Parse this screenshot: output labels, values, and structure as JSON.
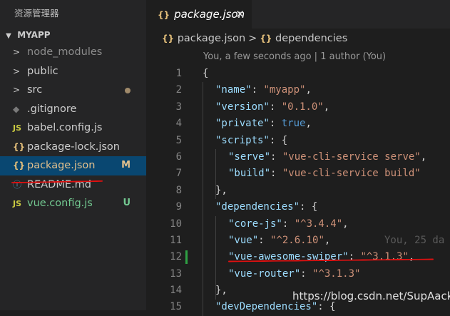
{
  "explorer": {
    "title": "资源管理器",
    "folder": "MYAPP",
    "items": [
      {
        "label": "node_modules",
        "icon": ">",
        "icon_name": "chevron-right-icon",
        "color": "#8c8c8c",
        "icon_color": "#cccccc"
      },
      {
        "label": "public",
        "icon": ">",
        "icon_name": "chevron-right-icon",
        "color": "#cccccc",
        "icon_color": "#cccccc"
      },
      {
        "label": "src",
        "icon": ">",
        "icon_name": "chevron-right-icon",
        "color": "#cccccc",
        "icon_color": "#cccccc"
      },
      {
        "label": ".gitignore",
        "icon": "◆",
        "icon_name": "git-icon",
        "color": "#cccccc",
        "icon_color": "#7a7a7a"
      },
      {
        "label": "babel.config.js",
        "icon": "JS",
        "icon_name": "javascript-file-icon",
        "color": "#cccccc",
        "icon_color": "#cbcb41"
      },
      {
        "label": "package-lock.json",
        "icon": "{}",
        "icon_name": "json-file-icon",
        "color": "#cccccc",
        "icon_color": "#e5c07b"
      },
      {
        "label": "package.json",
        "icon": "{}",
        "icon_name": "json-file-icon",
        "color": "#e2c08d",
        "icon_color": "#e5c07b",
        "badge": "M",
        "badge_color": "#e2c08d"
      },
      {
        "label": "README.md",
        "icon": "ⓘ",
        "icon_name": "info-icon",
        "color": "#cccccc",
        "icon_color": "#519aba"
      },
      {
        "label": "vue.config.js",
        "icon": "JS",
        "icon_name": "javascript-file-icon",
        "color": "#73c991",
        "icon_color": "#cbcb41",
        "badge": "U",
        "badge_color": "#73c991"
      }
    ]
  },
  "tab": {
    "braces": "{}",
    "filename": "package.json",
    "close": "✕"
  },
  "breadcrumb": {
    "braces1": "{}",
    "file": "package.json",
    "sep": ">",
    "braces2": "{}",
    "section": "dependencies"
  },
  "codelens": "You, a few seconds ago | 1 author (You)",
  "code": [
    {
      "n": "1",
      "indent": 0,
      "parts": [
        [
          "{",
          "p"
        ]
      ]
    },
    {
      "n": "2",
      "indent": 1,
      "parts": [
        [
          "\"name\"",
          "k"
        ],
        [
          ": ",
          "p"
        ],
        [
          "\"myapp\"",
          "s"
        ],
        [
          ",",
          "p"
        ]
      ]
    },
    {
      "n": "3",
      "indent": 1,
      "parts": [
        [
          "\"version\"",
          "k"
        ],
        [
          ": ",
          "p"
        ],
        [
          "\"0.1.0\"",
          "s"
        ],
        [
          ",",
          "p"
        ]
      ]
    },
    {
      "n": "4",
      "indent": 1,
      "parts": [
        [
          "\"private\"",
          "k"
        ],
        [
          ": ",
          "p"
        ],
        [
          "true",
          "b"
        ],
        [
          ",",
          "p"
        ]
      ]
    },
    {
      "n": "5",
      "indent": 1,
      "parts": [
        [
          "\"scripts\"",
          "k"
        ],
        [
          ": {",
          "p"
        ]
      ]
    },
    {
      "n": "6",
      "indent": 2,
      "parts": [
        [
          "\"serve\"",
          "k"
        ],
        [
          ": ",
          "p"
        ],
        [
          "\"vue-cli-service serve\"",
          "s"
        ],
        [
          ",",
          "p"
        ]
      ]
    },
    {
      "n": "7",
      "indent": 2,
      "parts": [
        [
          "\"build\"",
          "k"
        ],
        [
          ": ",
          "p"
        ],
        [
          "\"vue-cli-service build\"",
          "s"
        ]
      ]
    },
    {
      "n": "8",
      "indent": 1,
      "parts": [
        [
          "},",
          "p"
        ]
      ]
    },
    {
      "n": "9",
      "indent": 1,
      "parts": [
        [
          "\"dependencies\"",
          "k"
        ],
        [
          ": ",
          "p"
        ],
        [
          "{",
          "p"
        ]
      ]
    },
    {
      "n": "10",
      "indent": 2,
      "parts": [
        [
          "\"core-js\"",
          "k"
        ],
        [
          ": ",
          "p"
        ],
        [
          "\"^3.4.4\"",
          "s"
        ],
        [
          ",",
          "p"
        ]
      ]
    },
    {
      "n": "11",
      "indent": 2,
      "parts": [
        [
          "\"vue\"",
          "k"
        ],
        [
          ": ",
          "p"
        ],
        [
          "\"^2.6.10\"",
          "s"
        ],
        [
          ",",
          "p"
        ]
      ],
      "blame": "You, 25 da"
    },
    {
      "n": "12",
      "indent": 2,
      "parts": [
        [
          "\"vue-awesome-swiper\"",
          "k"
        ],
        [
          ": ",
          "p"
        ],
        [
          "\"^3.1.3\"",
          "s"
        ],
        [
          ",",
          "p"
        ]
      ],
      "modified": true
    },
    {
      "n": "13",
      "indent": 2,
      "parts": [
        [
          "\"vue-router\"",
          "k"
        ],
        [
          ": ",
          "p"
        ],
        [
          "\"^3.1.3\"",
          "s"
        ]
      ]
    },
    {
      "n": "14",
      "indent": 1,
      "parts": [
        [
          "},",
          "p"
        ]
      ]
    },
    {
      "n": "15",
      "indent": 1,
      "parts": [
        [
          "\"devDependencies\"",
          "k"
        ],
        [
          ": {",
          "p"
        ]
      ]
    }
  ],
  "watermark": "https://blog.csdn.net/SupAack"
}
